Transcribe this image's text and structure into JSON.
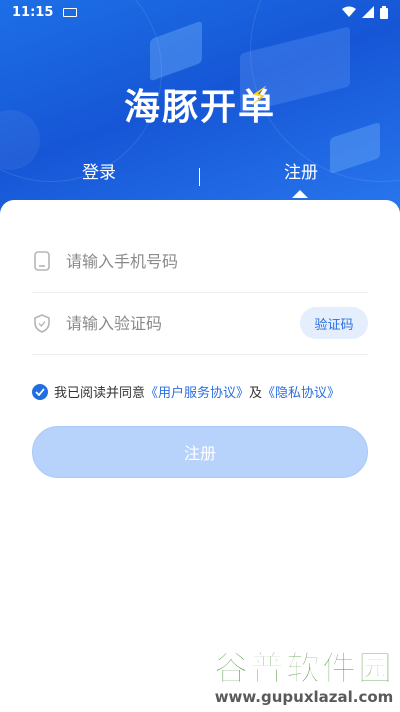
{
  "status_bar": {
    "time": "11:15"
  },
  "app": {
    "logo": "海豚开单"
  },
  "tabs": [
    {
      "label": "登录"
    },
    {
      "label": "注册",
      "active": true
    }
  ],
  "form": {
    "phone_placeholder": "请输入手机号码",
    "code_placeholder": "请输入验证码",
    "code_button": "验证码",
    "agreement": {
      "prefix": "我已阅读并同意",
      "user_agreement": "《用户服务协议》",
      "and": "及",
      "privacy": "《隐私协议》",
      "checked": true
    },
    "submit_label": "注册"
  },
  "watermark": {
    "title": "谷普软件园",
    "url": "www.gupuxlazal.com"
  },
  "colors": {
    "primary": "#1f6fe0",
    "hero": "#1656d6",
    "button_disabled": "#b8d3fb"
  },
  "icons": [
    "keyboard-icon",
    "wifi-icon",
    "signal-icon",
    "battery-icon",
    "phone-icon",
    "shield-icon",
    "check-icon",
    "bolt-icon"
  ]
}
